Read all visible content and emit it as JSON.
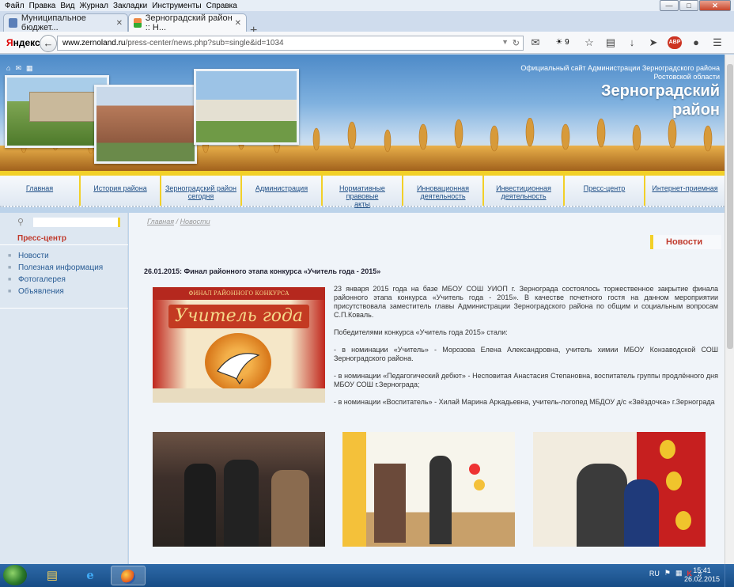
{
  "menubar": {
    "items": [
      "Файл",
      "Правка",
      "Вид",
      "Журнал",
      "Закладки",
      "Инструменты",
      "Справка"
    ]
  },
  "tabs": [
    {
      "label": "Муниципальное бюджет..."
    },
    {
      "label": "Зерноградский район :: Н..."
    }
  ],
  "navbar": {
    "logo_red": "Я",
    "logo_black": "ндекс",
    "url_host": "www.zernoland.ru",
    "url_path": "/press-center/news.php?sub=single&id=1034",
    "weather": "9"
  },
  "header": {
    "official_line1": "Официальный сайт Администрации Зерноградского района",
    "official_line2": "Ростовской области",
    "title_line1": "Зерноградский",
    "title_line2": "район"
  },
  "mainnav": [
    {
      "line1": "Главная",
      "line2": ""
    },
    {
      "line1": "История района",
      "line2": ""
    },
    {
      "line1": "Зерноградский район",
      "line2": "сегодня"
    },
    {
      "line1": "Администрация",
      "line2": ""
    },
    {
      "line1": "Нормативные правовые",
      "line2": "акты"
    },
    {
      "line1": "Инновационная",
      "line2": "деятельность"
    },
    {
      "line1": "Инвестиционная",
      "line2": "деятельность"
    },
    {
      "line1": "Пресс-центр",
      "line2": ""
    },
    {
      "line1": "Интернет-приемная",
      "line2": ""
    }
  ],
  "sidebar": {
    "title": "Пресс-центр",
    "items": [
      "Новости",
      "Полезная информация",
      "Фотогалерея",
      "Объявления"
    ]
  },
  "content": {
    "breadcrumb_home": "Главная",
    "breadcrumb_sep": " / ",
    "breadcrumb_current": "Новости",
    "section": "Новости",
    "news_title": "26.01.2015: Финал районного этапа конкурса «Учитель года - 2015»",
    "photo_banner_top": "ФИНАЛ РАЙОННОГО КОНКУРСА",
    "photo_banner_main": "Учитель года",
    "paragraphs": [
      "23 января 2015 года на базе МБОУ СОШ УИОП г. Зернограда состоялось торжественное закрытие финала районного этапа конкурса «Учитель года - 2015». В качестве почетного гостя на данном мероприятии присутствовала заместитель главы Администрации Зерноградского района по общим и социальным вопросам С.П.Коваль.",
      "Победителями конкурса «Учитель года 2015» стали:",
      "- в номинации «Учитель» - Морозова Елена Александровна, учитель химии МБОУ Конзаводской СОШ Зерноградского района.",
      "- в номинации «Педагогический дебют» - Несповитая Анастасия Степановна, воспитатель группы продлённого дня МБОУ СОШ г.Зернограда;",
      "- в номинации «Воспитатель» - Хилай Марина Аркадьевна, учитель-логопед МБДОУ д/с «Звёздочка» г.Зернограда"
    ]
  },
  "taskbar": {
    "lang": "RU",
    "time": "15:41",
    "date": "26.02.2015"
  }
}
